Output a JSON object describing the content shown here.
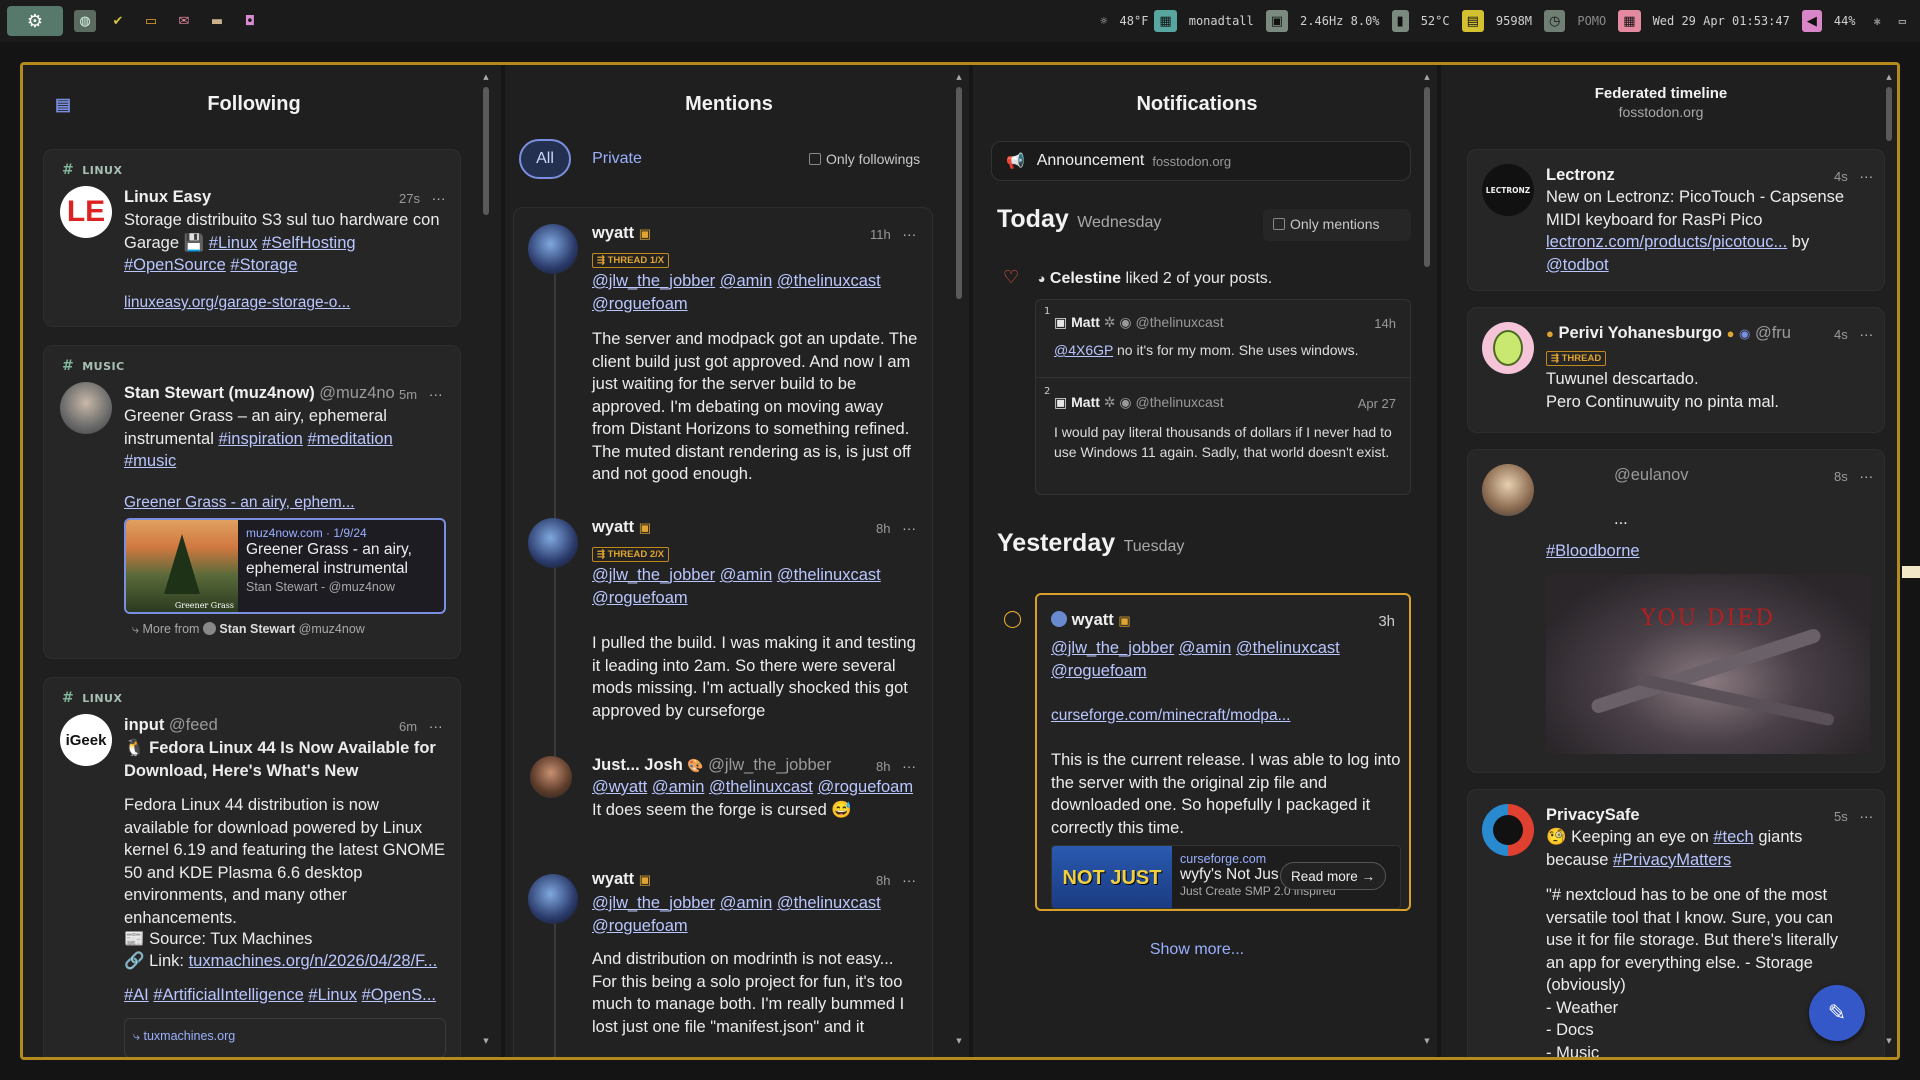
{
  "topbar": {
    "weather": "48°F",
    "hostname": "monadtall",
    "cpu": "2.46Hz 8.0%",
    "temp": "52°C",
    "memory": "9598M",
    "pomo": "POMO",
    "datetime": "Wed 29 Apr 01:53:47",
    "volume": "44%"
  },
  "columns": {
    "following": {
      "title": "Following",
      "posts": [
        {
          "tag": "LINUX",
          "avatar_text": "LE",
          "name": "Linux Easy",
          "time": "27s",
          "text_plain": "Storage distribuito S3 sul tuo hardware con Garage",
          "text_emoji": "💾",
          "hashtags": [
            "#Linux",
            "#SelfHosting",
            "#OpenSource",
            "#Storage"
          ],
          "link": "linuxeasy.org/garage-storage-o..."
        },
        {
          "tag": "MUSIC",
          "name": "Stan Stewart (muz4now)",
          "handle": "@muz4no",
          "time": "5m",
          "text_plain": "Greener Grass – an airy, ephemeral instrumental",
          "hashtags": [
            "#inspiration",
            "#meditation",
            "#music"
          ],
          "link": "Greener Grass - an airy, ephem...",
          "preview": {
            "source": "muz4now.com · 1/9/24",
            "title": "Greener Grass - an airy, ephemeral instrumental",
            "author": "Stan Stewart - @muz4now",
            "thumb_caption": "Greener Grass"
          },
          "more_from_label": "More from",
          "more_from_name": "Stan Stewart",
          "more_from_handle": "@muz4now"
        },
        {
          "tag": "LINUX",
          "avatar_text": "iGeek",
          "name": "input",
          "handle": "@feed",
          "time": "6m",
          "headline": "Fedora Linux 44 Is Now Available for Download, Here's What's New",
          "body": "Fedora Linux 44 distribution is now available for download powered by Linux kernel 6.19 and featuring the latest GNOME 50 and KDE Plasma 6.6 desktop environments, and many other enhancements.",
          "source_line": "📰 Source: Tux Machines",
          "link_label": "🔗 Link:",
          "link": "tuxmachines.org/n/2026/04/28/F...",
          "hashtags": [
            "#AI",
            "#ArtificialIntelligence",
            "#Linux",
            "#OpenS..."
          ],
          "footer_link": "tuxmachines.org"
        }
      ]
    },
    "mentions": {
      "title": "Mentions",
      "tab_all": "All",
      "tab_private": "Private",
      "only_followings": "Only followings",
      "posts": [
        {
          "name": "wyatt",
          "time": "11h",
          "badge": "THREAD 1/X",
          "mentions": [
            "@jlw_the_jobber",
            "@amin",
            "@thelinuxcast",
            "@roguefoam"
          ],
          "text": "The server and modpack got an update. The client build just got approved. And now I am just waiting for the server build to be approved. I'm debating on moving away from Distant Horizons to something refined. The muted distant rendering as is, is just off and not good enough."
        },
        {
          "name": "wyatt",
          "time": "8h",
          "badge": "THREAD 2/X",
          "mentions": [
            "@jlw_the_jobber",
            "@amin",
            "@thelinuxcast",
            "@roguefoam"
          ],
          "text": "I pulled the build. I was making it and testing it leading into 2am. So there were several mods missing. I'm actually shocked this got approved by curseforge"
        },
        {
          "name": "Just... Josh",
          "handle": "@jlw_the_jobber",
          "time": "8h",
          "mentions": [
            "@wyatt",
            "@amin",
            "@thelinuxcast",
            "@roguefoam"
          ],
          "text": "It does seem the forge is cursed 😅"
        },
        {
          "name": "wyatt",
          "time": "8h",
          "mentions": [
            "@jlw_the_jobber",
            "@amin",
            "@thelinuxcast",
            "@roguefoam"
          ],
          "text": "And distribution on modrinth is not easy... For this being a solo project for fun, it's too much to manage both. I'm really bummed I lost just one file \"manifest.json\" and it"
        }
      ]
    },
    "notifications": {
      "title": "Notifications",
      "announcement_label": "Announcement",
      "announcement_domain": "fosstodon.org",
      "today_label": "Today",
      "today_day": "Wednesday",
      "only_mentions": "Only mentions",
      "like_actor": "Celestine",
      "like_text": "liked 2 of your posts.",
      "liked_posts": [
        {
          "num": "1",
          "name": "Matt",
          "handle": "@thelinuxcast",
          "time": "14h",
          "mention": "@4X6GP",
          "text": "no it's for my mom. She uses windows."
        },
        {
          "num": "2",
          "name": "Matt",
          "handle": "@thelinuxcast",
          "time": "Apr 27",
          "text": "I would pay literal thousands of dollars if I never had to use Windows 11 again. Sadly, that world doesn't exist."
        }
      ],
      "yesterday_label": "Yesterday",
      "yesterday_day": "Tuesday",
      "mention_post": {
        "name": "wyatt",
        "time": "3h",
        "mentions": [
          "@jlw_the_jobber",
          "@amin",
          "@thelinuxcast",
          "@roguefoam"
        ],
        "link": "curseforge.com/minecraft/modpa...",
        "text": "This is the current release. I was able to log into the server with the original zip file and downloaded one. So hopefully I packaged it correctly this time.",
        "preview_domain": "curseforge.com",
        "preview_title": "wyfy's Not Jus",
        "preview_desc": "Just Create SMP 2.0 inspired",
        "preview_thumb": "NOT JUST",
        "read_more": "Read more →"
      },
      "show_more": "Show more..."
    },
    "federated": {
      "title": "Federated timeline",
      "subtitle": "fosstodon.org",
      "posts": [
        {
          "avatar_text": "LECTRONZ",
          "name": "Lectronz",
          "time": "4s",
          "text": "New on Lectronz: PicoTouch - Capsense MIDI keyboard for RasPi Pico",
          "link": "lectronz.com/products/picotouc...",
          "by": "by",
          "mention": "@todbot"
        },
        {
          "name": "Perivi Yohanesburgo",
          "handle": "@fru",
          "time": "4s",
          "badge": "THREAD",
          "line1": "Tuwunel descartado.",
          "line2": "Pero Continuwuity no pinta mal."
        },
        {
          "handle": "@eulanov",
          "time": "8s",
          "ellipsis": "...",
          "hashtag": "#Bloodborne",
          "image_text": "YOU DIED"
        },
        {
          "name": "PrivacySafe",
          "time": "5s",
          "intro_emoji": "🧐",
          "intro": "Keeping an eye on",
          "hashtag1": "#tech",
          "intro_mid": "giants because",
          "hashtag2": "#PrivacyMatters",
          "quote": "\"# nextcloud   has to be one of the most versatile tool that I know.  Sure, you can use it for file storage.  But there's literally an app for everything else.  - Storage (obviously)",
          "list1": "- Weather",
          "list2": "- Docs",
          "list3": "- Music"
        }
      ]
    }
  },
  "colors": {
    "frame_border": "#b58a1c",
    "accent": "#7a8fe0",
    "link": "#b9c6ff",
    "thread_badge": "#e0a531",
    "highlight_border": "#d9a12a"
  }
}
